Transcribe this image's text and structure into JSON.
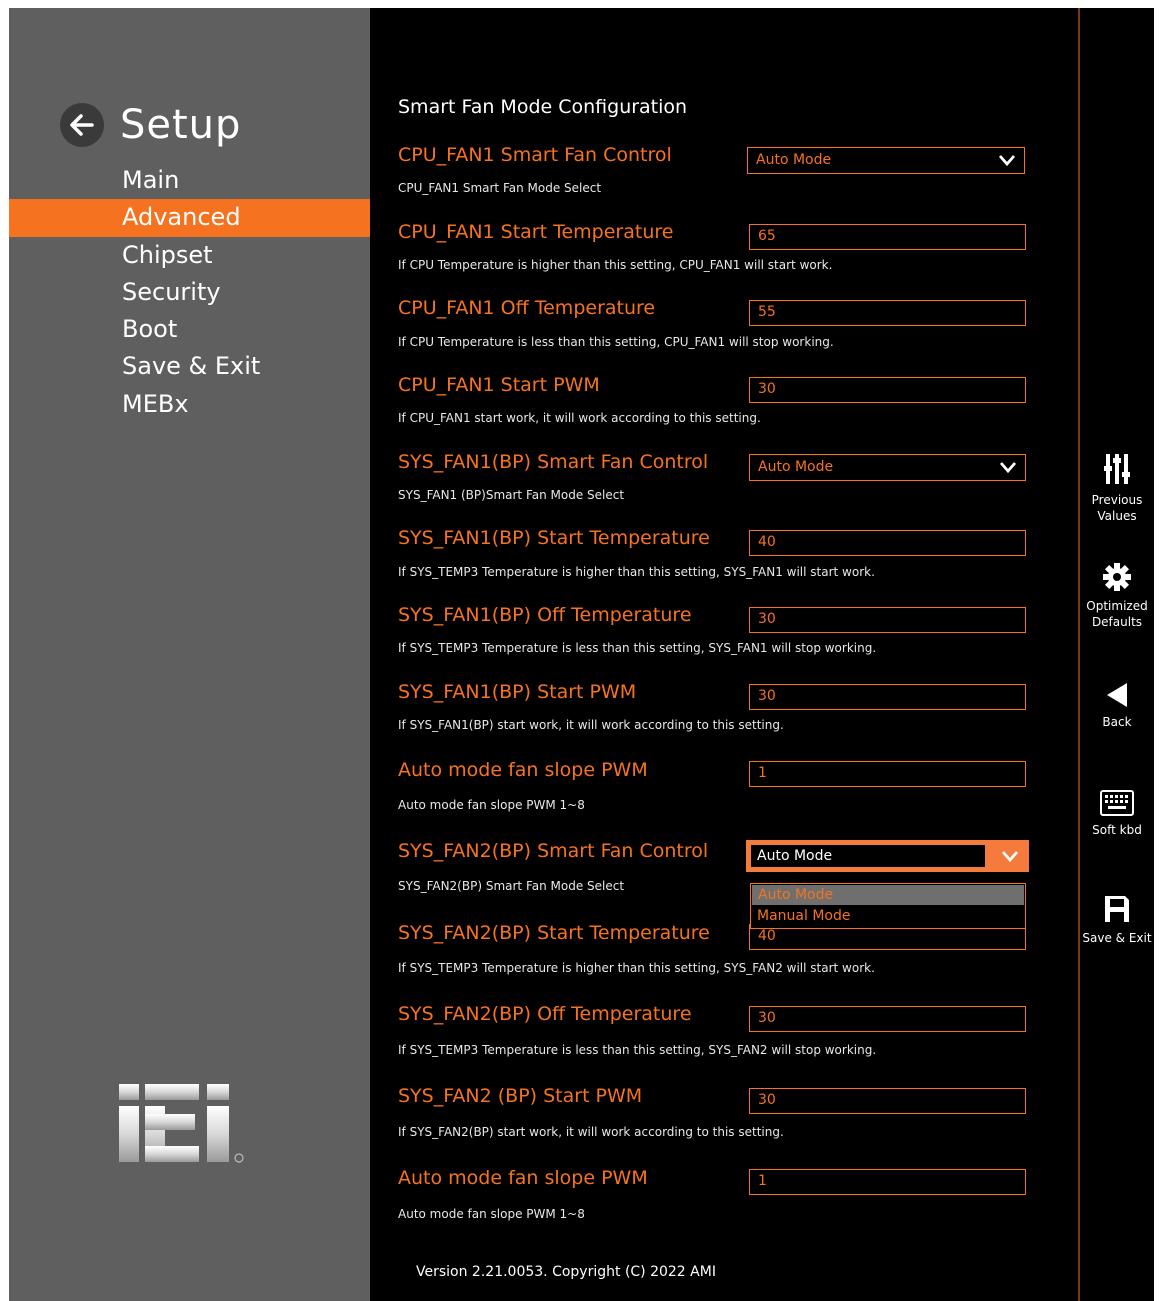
{
  "sidebar": {
    "title": "Setup",
    "items": [
      {
        "label": "Main"
      },
      {
        "label": "Advanced"
      },
      {
        "label": "Chipset"
      },
      {
        "label": "Security"
      },
      {
        "label": "Boot"
      },
      {
        "label": "Save & Exit"
      },
      {
        "label": "MEBx"
      }
    ],
    "active_item": "Advanced"
  },
  "main": {
    "section_title": "Smart Fan Mode Configuration",
    "rows": [
      {
        "label": "CPU_FAN1 Smart Fan Control",
        "help": "CPU_FAN1 Smart Fan Mode Select",
        "type": "select",
        "value": "Auto Mode"
      },
      {
        "label": "CPU_FAN1 Start Temperature",
        "help": "If CPU Temperature is higher than this setting, CPU_FAN1 will start work.",
        "type": "input",
        "value": "65"
      },
      {
        "label": "CPU_FAN1 Off Temperature",
        "help": "If CPU Temperature is less than this setting, CPU_FAN1 will stop working.",
        "type": "input",
        "value": "55"
      },
      {
        "label": "CPU_FAN1 Start PWM",
        "help": "If CPU_FAN1 start work, it will work according to this setting.",
        "type": "input",
        "value": "30"
      },
      {
        "label": "SYS_FAN1(BP) Smart Fan Control",
        "help": "SYS_FAN1 (BP)Smart Fan Mode Select",
        "type": "select",
        "value": "Auto Mode"
      },
      {
        "label": "SYS_FAN1(BP) Start Temperature",
        "help": "If SYS_TEMP3 Temperature is higher than this setting, SYS_FAN1 will start work.",
        "type": "input",
        "value": "40"
      },
      {
        "label": "SYS_FAN1(BP) Off Temperature",
        "help": "If SYS_TEMP3 Temperature is less than this setting, SYS_FAN1 will stop working.",
        "type": "input",
        "value": "30"
      },
      {
        "label": "SYS_FAN1(BP) Start PWM",
        "help": "If SYS_FAN1(BP) start work, it will work according to this setting.",
        "type": "input",
        "value": "30"
      },
      {
        "label": "Auto mode fan slope PWM",
        "help": "Auto mode fan slope PWM 1~8",
        "type": "input",
        "value": "1"
      },
      {
        "label": "SYS_FAN2(BP) Smart Fan Control",
        "help": "SYS_FAN2(BP) Smart Fan Mode Select",
        "type": "select-open",
        "value": "Auto Mode"
      },
      {
        "label": "SYS_FAN2(BP) Start Temperature",
        "help": "If SYS_TEMP3 Temperature is higher than this setting, SYS_FAN2 will start work.",
        "type": "input",
        "value": "40"
      },
      {
        "label": "SYS_FAN2(BP) Off Temperature",
        "help": "If SYS_TEMP3 Temperature is less than this setting, SYS_FAN2 will stop working.",
        "type": "input",
        "value": "30"
      },
      {
        "label": "SYS_FAN2 (BP) Start PWM",
        "help": "If SYS_FAN2(BP) start work, it will work according to this setting.",
        "type": "input",
        "value": "30"
      },
      {
        "label": "Auto mode fan slope PWM",
        "help": "Auto mode fan slope PWM 1~8",
        "type": "input",
        "value": "1"
      }
    ],
    "dropdown_options": [
      "Auto Mode",
      "Manual Mode"
    ],
    "dropdown_highlighted": "Auto Mode",
    "footer": "Version 2.21.0053. Copyright (C) 2022 AMI"
  },
  "toolbar": {
    "items": [
      {
        "label": "Previous Values",
        "icon": "sliders-icon"
      },
      {
        "label": "Optimized Defaults",
        "icon": "gear-icon"
      },
      {
        "label": "Back",
        "icon": "back-triangle-icon"
      },
      {
        "label": "Soft kbd",
        "icon": "keyboard-icon"
      },
      {
        "label": "Save & Exit",
        "icon": "floppy-icon"
      }
    ]
  },
  "colors": {
    "accent": "#f57320",
    "sidebar": "#5f5f5f",
    "background": "#000000",
    "highlight": "#6f6f6f"
  }
}
